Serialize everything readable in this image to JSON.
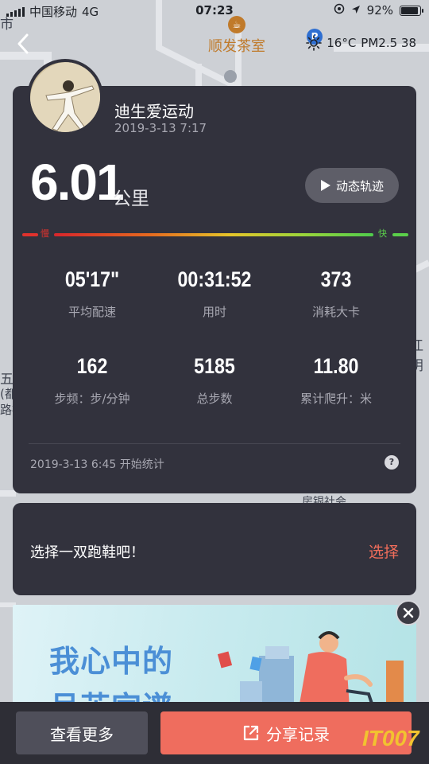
{
  "status_bar": {
    "carrier": "中国移动",
    "network": "4G",
    "time": "07:23",
    "battery": "92%",
    "battery_level": 0.92
  },
  "map": {
    "poi_name": "顺发茶室",
    "labels": [
      "市",
      "五",
      "(都",
      "路社",
      "江阴",
      "房银社会"
    ]
  },
  "nav": {
    "back_icon": "chevron-left-icon"
  },
  "weather": {
    "icon": "sun-icon",
    "temperature": "16°C",
    "pm25": "PM2.5 38"
  },
  "user": {
    "name": "迪生爱运动",
    "date": "2019-3-13 7:17"
  },
  "run": {
    "distance": "6.01",
    "distance_unit": "公里",
    "track_button": "动态轨迹",
    "speed_slow": "慢",
    "speed_fast": "快",
    "stats": [
      {
        "value": "05'17\"",
        "label": "平均配速"
      },
      {
        "value": "00:31:52",
        "label": "用时"
      },
      {
        "value": "373",
        "label": "消耗大卡"
      },
      {
        "value": "162",
        "label": "步频：步/分钟"
      },
      {
        "value": "5185",
        "label": "总步数"
      },
      {
        "value": "11.80",
        "label": "累计爬升：米"
      }
    ],
    "start_text": "2019-3-13 6:45 开始统计",
    "help_icon": "question-icon"
  },
  "shoe": {
    "prompt": "选择一双跑鞋吧！",
    "select_label": "选择"
  },
  "ad": {
    "headline": "我心中的",
    "headline2": "月芷宫谱",
    "close_icon": "close-icon"
  },
  "bottom": {
    "more_label": "查看更多",
    "share_label": "分享记录"
  },
  "watermark": "IT007",
  "colors": {
    "card_bg": "#32323d",
    "accent_red": "#ef6d5e",
    "fast_green": "#5bcf4a",
    "slow_red": "#e0322d"
  }
}
